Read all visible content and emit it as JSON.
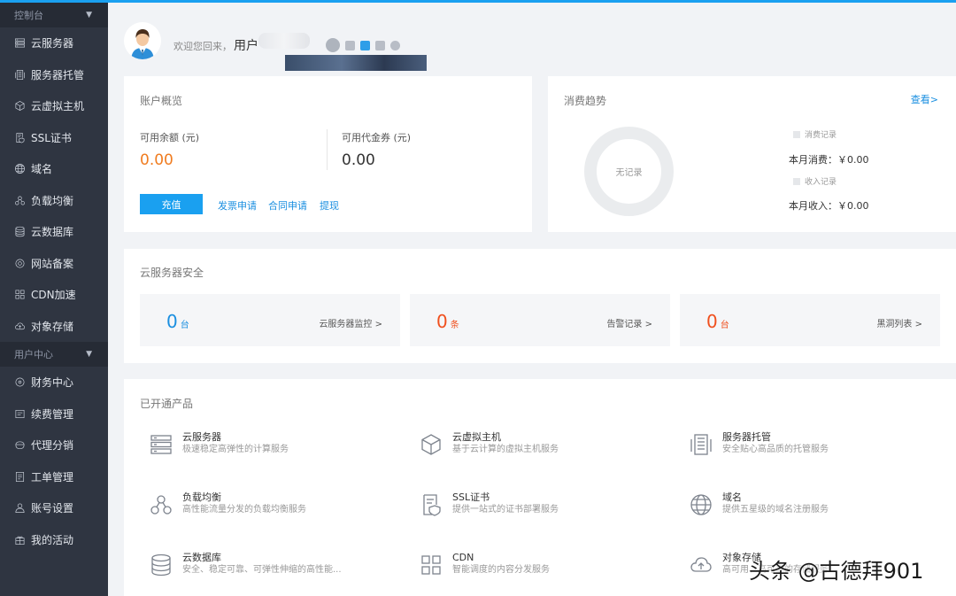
{
  "sidebar": {
    "section_console": "控制台",
    "section_user": "用户中心",
    "console_items": [
      {
        "label": "云服务器",
        "icon": "server-icon"
      },
      {
        "label": "服务器托管",
        "icon": "rack-icon"
      },
      {
        "label": "云虚拟主机",
        "icon": "cube-icon"
      },
      {
        "label": "SSL证书",
        "icon": "certificate-icon"
      },
      {
        "label": "域名",
        "icon": "globe-icon"
      },
      {
        "label": "负载均衡",
        "icon": "load-balance-icon"
      },
      {
        "label": "云数据库",
        "icon": "database-icon"
      },
      {
        "label": "网站备案",
        "icon": "record-icon"
      },
      {
        "label": "CDN加速",
        "icon": "cdn-icon"
      },
      {
        "label": "对象存储",
        "icon": "cloud-upload-icon"
      }
    ],
    "user_items": [
      {
        "label": "财务中心",
        "icon": "finance-icon"
      },
      {
        "label": "续费管理",
        "icon": "renew-icon"
      },
      {
        "label": "代理分销",
        "icon": "agent-icon"
      },
      {
        "label": "工单管理",
        "icon": "ticket-icon"
      },
      {
        "label": "账号设置",
        "icon": "user-icon"
      },
      {
        "label": "我的活动",
        "icon": "gift-icon"
      }
    ]
  },
  "header": {
    "welcome": "欢迎您回来，",
    "username": "用户"
  },
  "account": {
    "title": "账户概览",
    "balance_label": "可用余额 (元)",
    "balance_value": "0.00",
    "voucher_label": "可用代金券 (元)",
    "voucher_value": "0.00",
    "recharge": "充值",
    "invoice": "发票申请",
    "contract": "合同申请",
    "withdraw": "提现"
  },
  "trend": {
    "title": "消费趋势",
    "more": "查看>",
    "empty": "无记录",
    "legend_spend": "消费记录",
    "legend_income": "收入记录",
    "month_spend": "本月消费：￥0.00",
    "month_income": "本月收入：￥0.00"
  },
  "security": {
    "title": "云服务器安全",
    "boxes": [
      {
        "num": "0",
        "unit": "台",
        "link": "云服务器监控 >",
        "color": "#1a8fe0"
      },
      {
        "num": "0",
        "unit": "条",
        "link": "告警记录 >",
        "color": "#f0501e"
      },
      {
        "num": "0",
        "unit": "台",
        "link": "黑洞列表 >",
        "color": "#f0501e"
      }
    ]
  },
  "products": {
    "title": "已开通产品",
    "items": [
      {
        "name": "云服务器",
        "desc": "极速稳定高弹性的计算服务",
        "icon": "server-icon"
      },
      {
        "name": "云虚拟主机",
        "desc": "基于云计算的虚拟主机服务",
        "icon": "cube-icon"
      },
      {
        "name": "服务器托管",
        "desc": "安全贴心高品质的托管服务",
        "icon": "rack-icon"
      },
      {
        "name": "负载均衡",
        "desc": "高性能流量分发的负载均衡服务",
        "icon": "load-balance-icon"
      },
      {
        "name": "SSL证书",
        "desc": "提供一站式的证书部署服务",
        "icon": "certificate-icon"
      },
      {
        "name": "域名",
        "desc": "提供五星级的域名注册服务",
        "icon": "globe-icon"
      },
      {
        "name": "云数据库",
        "desc": "安全、稳定可靠、可弹性伸缩的高性能...",
        "icon": "database-icon"
      },
      {
        "name": "CDN",
        "desc": "智能调度的内容分发服务",
        "icon": "cdn-icon"
      },
      {
        "name": "对象存储",
        "desc": "高可用、高可靠的存储服务",
        "icon": "cloud-upload-icon"
      }
    ]
  },
  "watermark": "头条 @古德拜901",
  "colors": {
    "accent": "#1aa0f0",
    "sidebar": "#2f3541",
    "orange": "#f07c20",
    "red": "#f0501e"
  }
}
